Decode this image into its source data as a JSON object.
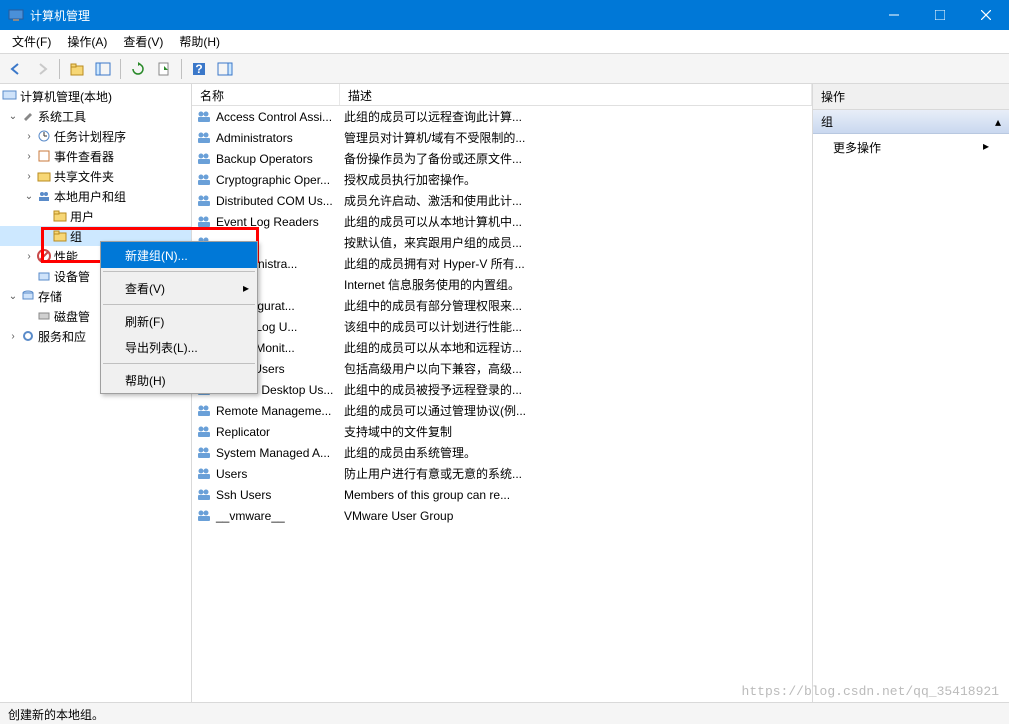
{
  "titlebar": {
    "title": "计算机管理"
  },
  "menubar": {
    "file": "文件(F)",
    "action": "操作(A)",
    "view": "查看(V)",
    "help": "帮助(H)"
  },
  "tree": {
    "root": "计算机管理(本地)",
    "system_tools": "系统工具",
    "task_scheduler": "任务计划程序",
    "event_viewer": "事件查看器",
    "shared_folders": "共享文件夹",
    "local_users_groups": "本地用户和组",
    "users": "用户",
    "groups": "组",
    "performance": "性能",
    "device_manager": "设备管",
    "storage": "存储",
    "disk_management": "磁盘管",
    "services_apps": "服务和应"
  },
  "context": {
    "new_group": "新建组(N)...",
    "view": "查看(V)",
    "refresh": "刷新(F)",
    "export_list": "导出列表(L)...",
    "help": "帮助(H)"
  },
  "list": {
    "col_name": "名称",
    "col_desc": "描述",
    "rows": [
      {
        "name": "Access Control Assi...",
        "desc": "此组的成员可以远程查询此计算..."
      },
      {
        "name": "Administrators",
        "desc": "管理员对计算机/域有不受限制的..."
      },
      {
        "name": "Backup Operators",
        "desc": "备份操作员为了备份或还原文件..."
      },
      {
        "name": "Cryptographic Oper...",
        "desc": "授权成员执行加密操作。"
      },
      {
        "name": "Distributed COM Us...",
        "desc": "成员允许启动、激活和使用此计..."
      },
      {
        "name": "Event Log Readers",
        "desc": "此组的成员可以从本地计算机中..."
      },
      {
        "name": "",
        "desc": "按默认值，来宾跟用户组的成员..."
      },
      {
        "name": "-V Administra...",
        "desc": "此组的成员拥有对 Hyper-V 所有..."
      },
      {
        "name": "SRS",
        "desc": "Internet 信息服务使用的内置组。"
      },
      {
        "name": "rk Configurat...",
        "desc": "此组中的成员有部分管理权限来..."
      },
      {
        "name": "mance Log U...",
        "desc": "该组中的成员可以计划进行性能..."
      },
      {
        "name": "mance Monit...",
        "desc": "此组的成员可以从本地和远程访..."
      },
      {
        "name": "Power Users",
        "desc": "包括高级用户以向下兼容，高级..."
      },
      {
        "name": "Remote Desktop Us...",
        "desc": "此组中的成员被授予远程登录的..."
      },
      {
        "name": "Remote Manageme...",
        "desc": "此组的成员可以通过管理协议(例..."
      },
      {
        "name": "Replicator",
        "desc": "支持域中的文件复制"
      },
      {
        "name": "System Managed A...",
        "desc": "此组的成员由系统管理。"
      },
      {
        "name": "Users",
        "desc": "防止用户进行有意或无意的系统..."
      },
      {
        "name": "Ssh Users",
        "desc": "Members of this group can re..."
      },
      {
        "name": "__vmware__",
        "desc": "VMware User Group"
      }
    ]
  },
  "actions": {
    "header": "操作",
    "group_label": "组",
    "more_actions": "更多操作"
  },
  "status": {
    "text": "创建新的本地组。"
  },
  "watermark": "https://blog.csdn.net/qq_35418921"
}
